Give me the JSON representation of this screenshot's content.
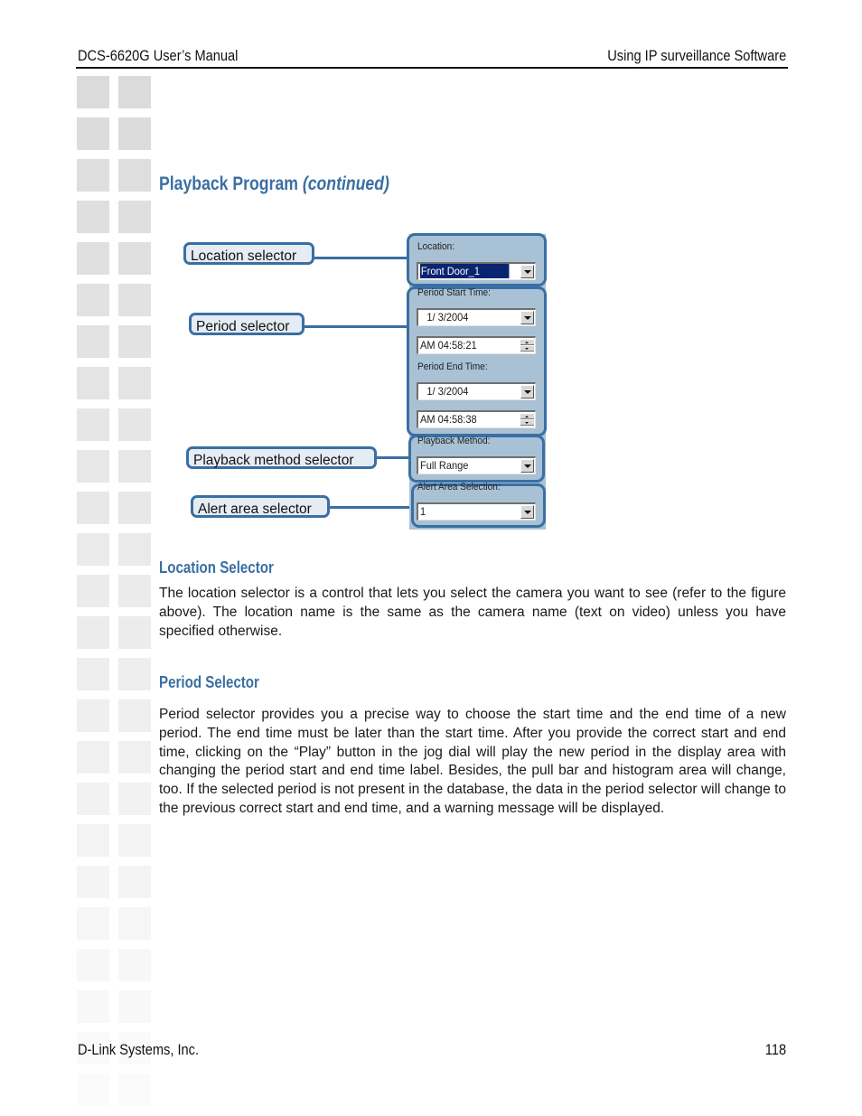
{
  "header": {
    "manual_title": "DCS-6620G User’s Manual",
    "section_title": "Using IP surveillance Software"
  },
  "page_title": {
    "main": "Playback Program",
    "suffix": "(continued)"
  },
  "figure": {
    "callouts": {
      "location": "Location selector",
      "period": "Period selector",
      "playback_method": "Playback method selector",
      "alert_area": "Alert area selector"
    },
    "panel": {
      "location_label": "Location:",
      "location_value": "Front Door_1",
      "period_start_label": "Period Start Time:",
      "period_start_date": "1/  3/2004",
      "period_start_time": "AM 04:58:21",
      "period_end_label": "Period End Time:",
      "period_end_date": "1/  3/2004",
      "period_end_time": "AM 04:58:38",
      "playback_method_label": "Playback Method:",
      "playback_method_value": "Full Range",
      "alert_area_label": "Alert Area Selection:",
      "alert_area_value": "1"
    }
  },
  "sections": [
    {
      "heading": "Location Selector",
      "body": "The location selector is a control that lets you select the camera you want to see (refer to the figure above). The location name is the same as the camera name (text on video) unless you have specified otherwise."
    },
    {
      "heading": "Period Selector",
      "body": "Period selector provides you a precise way to choose the start time and the end time of a new period. The end time must be later than the start time. After you provide the correct start and end time, clicking on the “Play” button in the jog dial will play the new period in the display area with changing the period start and end time label. Besides, the pull bar and histogram area will change, too. If the selected period is not present in the database, the data in the period selector will change to the previous correct start and end time, and a warning message will be displayed."
    }
  ],
  "footer": {
    "company": "D-Link Systems, Inc.",
    "page_number": "118"
  },
  "colors": {
    "accent": "#3a6fa3",
    "panel_bg": "#a9c1d5",
    "callout_bg": "#e6ecf4",
    "selection": "#0a2470"
  }
}
